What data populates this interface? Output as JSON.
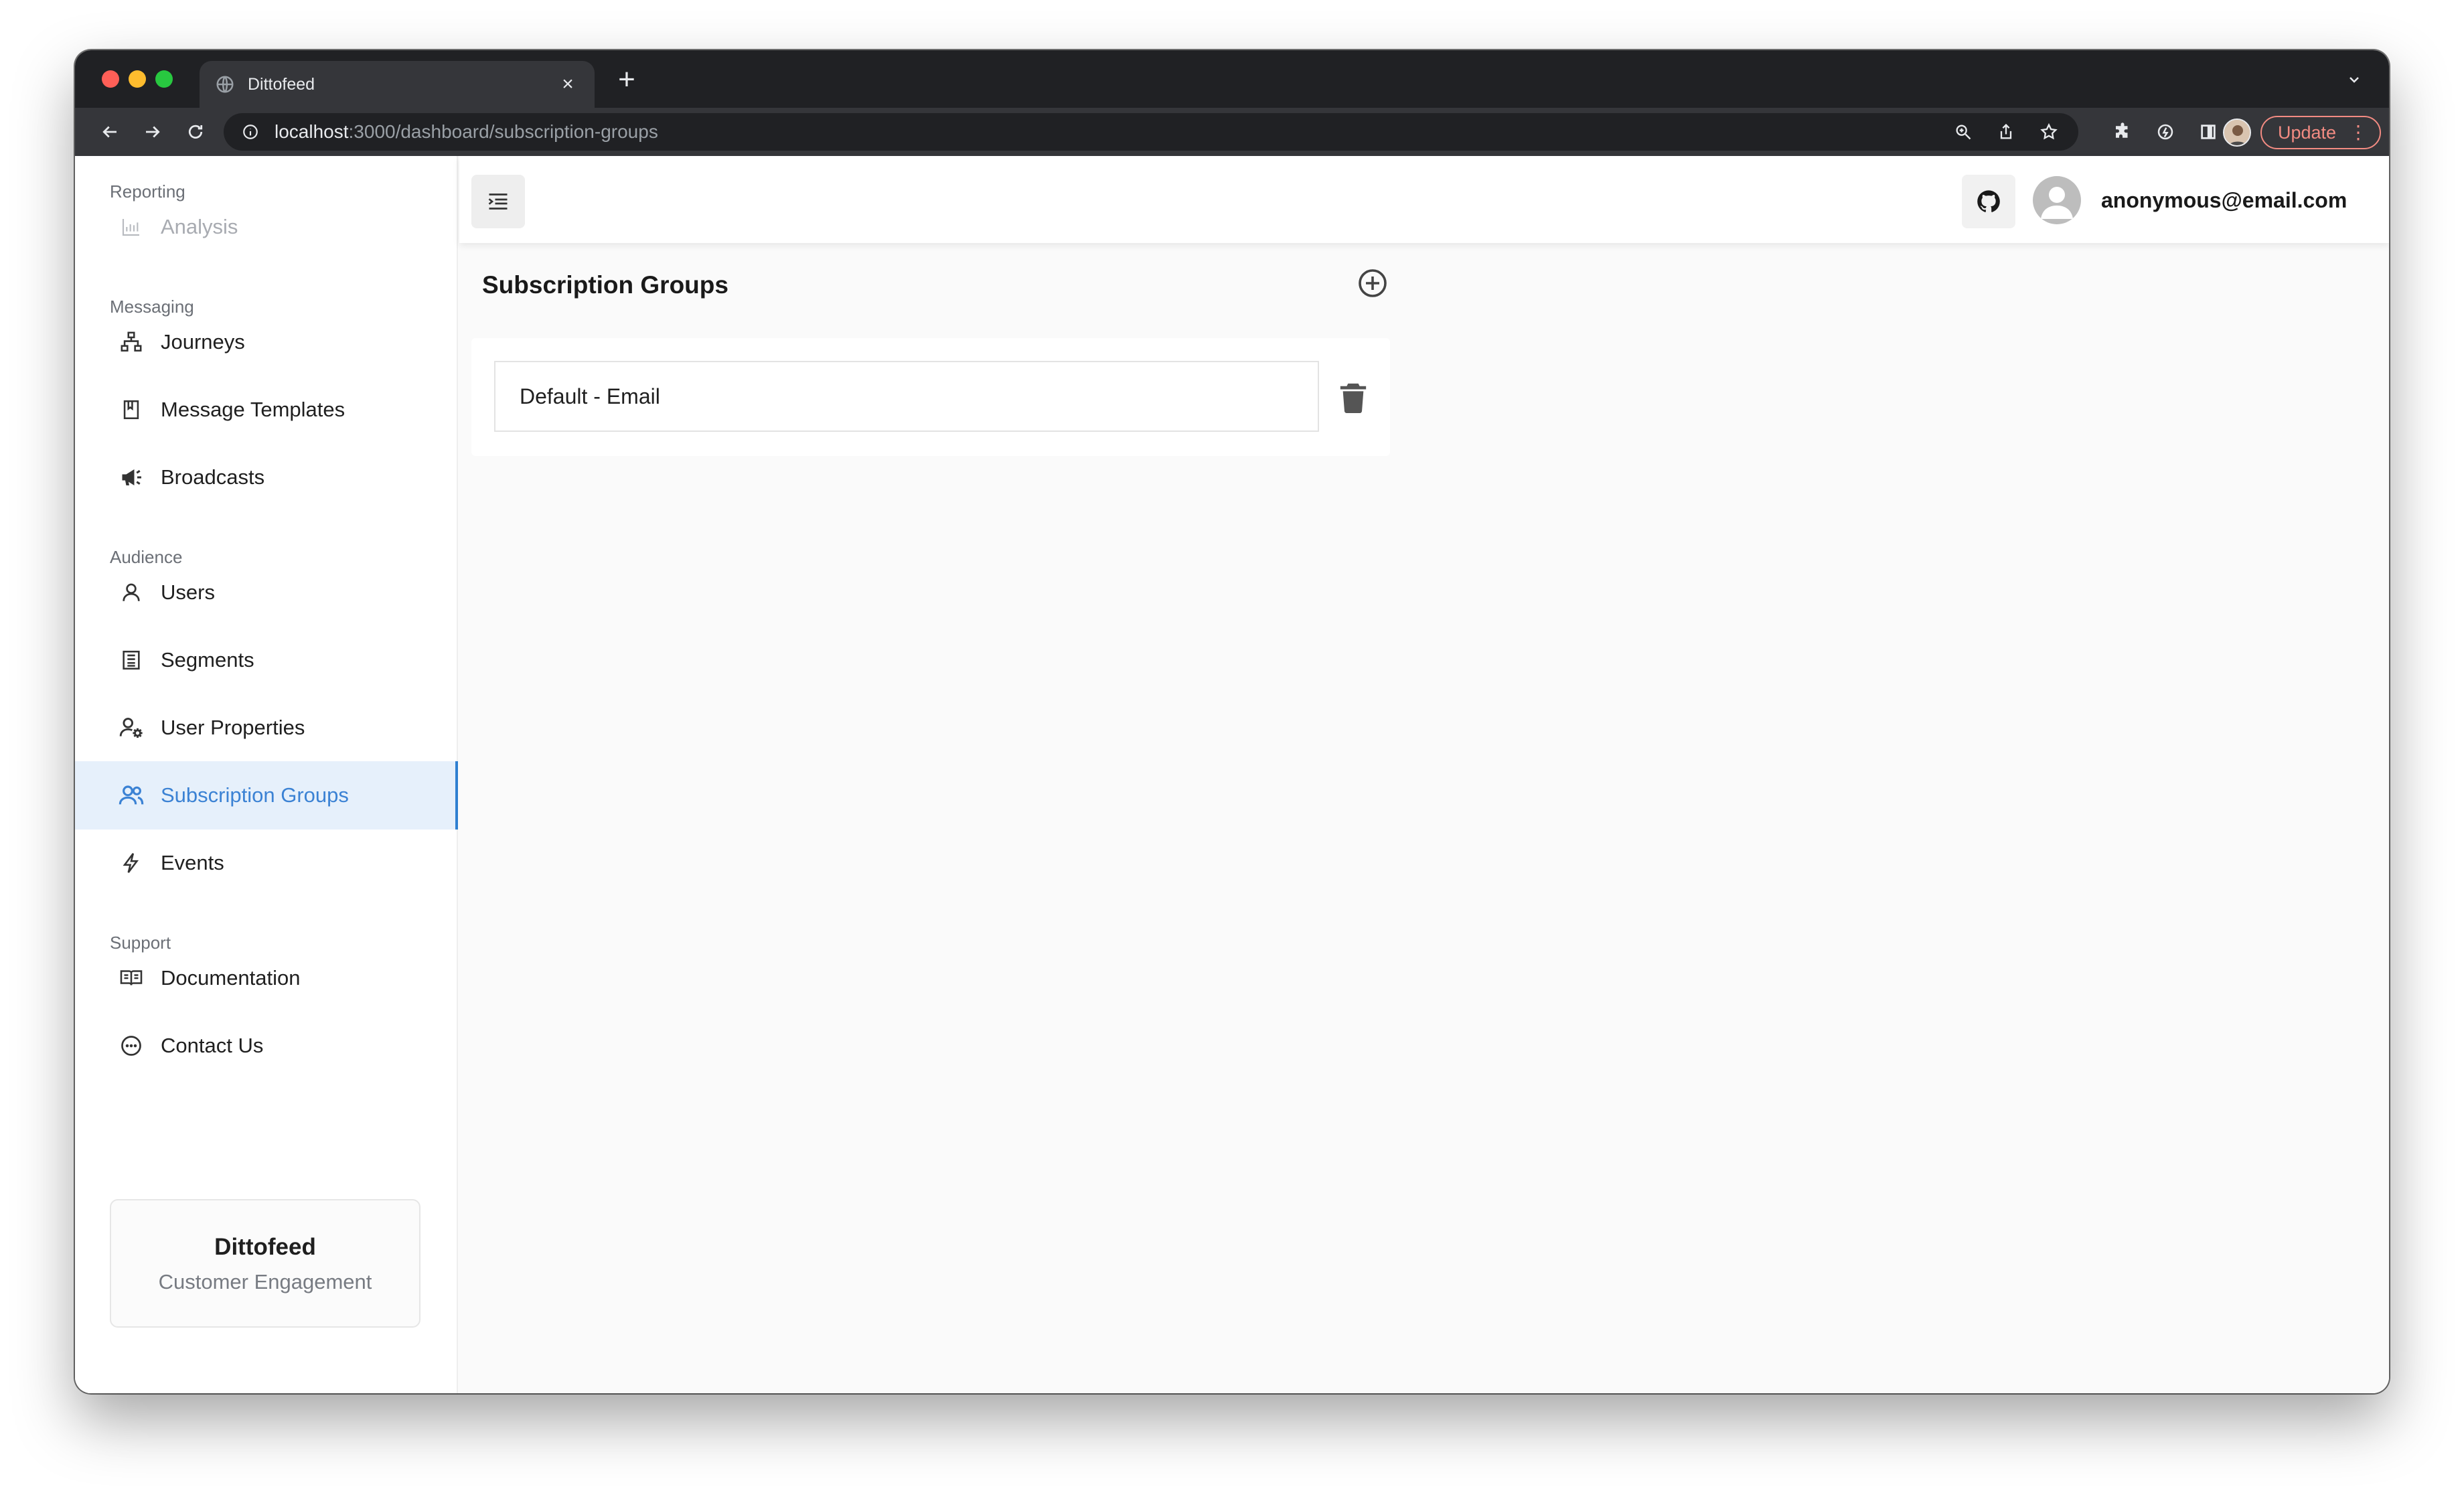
{
  "browser": {
    "tab_title": "Dittofeed",
    "tab_close": "×",
    "new_tab": "+",
    "url_host": "localhost",
    "url_path": ":3000/dashboard/subscription-groups",
    "update_label": "Update",
    "update_menu": "⋮"
  },
  "sidebar": {
    "sections": {
      "reporting": "Reporting",
      "messaging": "Messaging",
      "audience": "Audience",
      "support": "Support"
    },
    "items": {
      "analysis": "Analysis",
      "journeys": "Journeys",
      "message_templates": "Message Templates",
      "broadcasts": "Broadcasts",
      "users": "Users",
      "segments": "Segments",
      "user_properties": "User Properties",
      "subscription_groups": "Subscription Groups",
      "events": "Events",
      "documentation": "Documentation",
      "contact_us": "Contact Us"
    },
    "active_item": "subscription_groups",
    "brand": {
      "name": "Dittofeed",
      "tagline": "Customer Engagement"
    }
  },
  "header": {
    "user_email": "anonymous@email.com"
  },
  "main": {
    "title": "Subscription Groups",
    "groups": [
      {
        "name": "Default - Email"
      }
    ]
  },
  "colors": {
    "accent": "#3b82d4",
    "active_bg": "#e6f0fb",
    "update": "#f28b82"
  }
}
